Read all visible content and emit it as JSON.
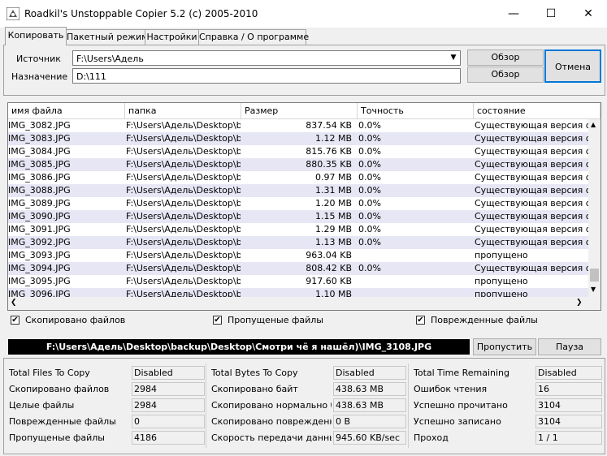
{
  "window": {
    "title": "Roadkil's Unstoppable Copier 5.2 (c) 2005-2010",
    "minimize": "—",
    "maximize": "☐",
    "close": "✕"
  },
  "tabs": [
    {
      "label": "Копировать"
    },
    {
      "label": "Пакетный режим"
    },
    {
      "label": "Настройки"
    },
    {
      "label": "Справка / О программе"
    }
  ],
  "copy_panel": {
    "source_label": "Источник",
    "source_value": "F:\\Users\\Адель",
    "dest_label": "Назначение",
    "dest_value": "D:\\111",
    "browse_label": "Обзор",
    "browse2_label": "Обзор",
    "cancel_label": "Отмена"
  },
  "table": {
    "columns": [
      "имя файла",
      "папка",
      "Размер",
      "Точность",
      "состояние"
    ],
    "rows": [
      {
        "name": "IMG_3082.JPG",
        "folder": "F:\\Users\\Адель\\Desktop\\ba",
        "size": "837.54 KB",
        "accuracy": "0.0%",
        "status": "Существующая версия са"
      },
      {
        "name": "IMG_3083.JPG",
        "folder": "F:\\Users\\Адель\\Desktop\\ba",
        "size": "1.12 MB",
        "accuracy": "0.0%",
        "status": "Существующая версия са"
      },
      {
        "name": "IMG_3084.JPG",
        "folder": "F:\\Users\\Адель\\Desktop\\ba",
        "size": "815.76 KB",
        "accuracy": "0.0%",
        "status": "Существующая версия са"
      },
      {
        "name": "IMG_3085.JPG",
        "folder": "F:\\Users\\Адель\\Desktop\\ba",
        "size": "880.35 KB",
        "accuracy": "0.0%",
        "status": "Существующая версия са"
      },
      {
        "name": "IMG_3086.JPG",
        "folder": "F:\\Users\\Адель\\Desktop\\ba",
        "size": "0.97 MB",
        "accuracy": "0.0%",
        "status": "Существующая версия са"
      },
      {
        "name": "IMG_3088.JPG",
        "folder": "F:\\Users\\Адель\\Desktop\\ba",
        "size": "1.31 MB",
        "accuracy": "0.0%",
        "status": "Существующая версия са"
      },
      {
        "name": "IMG_3089.JPG",
        "folder": "F:\\Users\\Адель\\Desktop\\ba",
        "size": "1.20 MB",
        "accuracy": "0.0%",
        "status": "Существующая версия са"
      },
      {
        "name": "IMG_3090.JPG",
        "folder": "F:\\Users\\Адель\\Desktop\\ba",
        "size": "1.15 MB",
        "accuracy": "0.0%",
        "status": "Существующая версия са"
      },
      {
        "name": "IMG_3091.JPG",
        "folder": "F:\\Users\\Адель\\Desktop\\ba",
        "size": "1.29 MB",
        "accuracy": "0.0%",
        "status": "Существующая версия са"
      },
      {
        "name": "IMG_3092.JPG",
        "folder": "F:\\Users\\Адель\\Desktop\\ba",
        "size": "1.13 MB",
        "accuracy": "0.0%",
        "status": "Существующая версия са"
      },
      {
        "name": "IMG_3093.JPG",
        "folder": "F:\\Users\\Адель\\Desktop\\ba",
        "size": "963.04 KB",
        "accuracy": "",
        "status": "пропущено"
      },
      {
        "name": "IMG_3094.JPG",
        "folder": "F:\\Users\\Адель\\Desktop\\ba",
        "size": "808.42 KB",
        "accuracy": "0.0%",
        "status": "Существующая версия са"
      },
      {
        "name": "IMG_3095.JPG",
        "folder": "F:\\Users\\Адель\\Desktop\\ba",
        "size": "917.60 KB",
        "accuracy": "",
        "status": "пропущено"
      },
      {
        "name": "IMG_3096.JPG",
        "folder": "F:\\Users\\Адель\\Desktop\\ba",
        "size": "1.10 MB",
        "accuracy": "",
        "status": "пропущено"
      }
    ]
  },
  "filters": {
    "copied_label": "Скопировано файлов",
    "copied_checked": true,
    "skipped_label": "Пропущеные файлы",
    "skipped_checked": true,
    "damaged_label": "Поврежденные файлы",
    "damaged_checked": true
  },
  "current_file": "F:\\Users\\Адель\\Desktop\\backup\\Desktop\\Смотри чё я нашёл)\\IMG_3108.JPG",
  "skip_label": "Пропустить",
  "pause_label": "Пауза",
  "stats": {
    "col1": [
      {
        "label": "Total Files To Copy",
        "value": "Disabled"
      },
      {
        "label": "Скопировано файлов",
        "value": "2984"
      },
      {
        "label": "Целые файлы",
        "value": "2984"
      },
      {
        "label": "Поврежденные файлы",
        "value": "0"
      },
      {
        "label": "Пропущеные файлы",
        "value": "4186"
      }
    ],
    "col2": [
      {
        "label": "Total Bytes To Copy",
        "value": "Disabled"
      },
      {
        "label": "Скопировано байт",
        "value": "438.63 MB"
      },
      {
        "label": "Скопировано нормально байт",
        "value": "438.63 MB"
      },
      {
        "label": "Скопировано поврежденных",
        "value": "0 B"
      },
      {
        "label": "Скорость передачи данных",
        "value": "945.60 KB/sec"
      }
    ],
    "col3": [
      {
        "label": "Total Time Remaining",
        "value": "Disabled"
      },
      {
        "label": "Ошибок чтения",
        "value": "16"
      },
      {
        "label": "Успешно прочитано",
        "value": "3104"
      },
      {
        "label": "Успешно записано",
        "value": "3104"
      },
      {
        "label": "Проход",
        "value": "1 / 1"
      }
    ]
  }
}
